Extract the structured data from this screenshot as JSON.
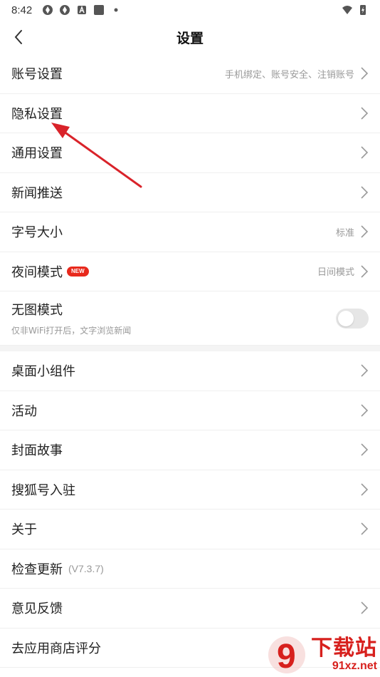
{
  "status_bar": {
    "time": "8:42"
  },
  "header": {
    "title": "设置"
  },
  "settings_group1": [
    {
      "label": "账号设置",
      "value": "手机绑定、账号安全、注销账号"
    },
    {
      "label": "隐私设置",
      "value": ""
    },
    {
      "label": "通用设置",
      "value": ""
    },
    {
      "label": "新闻推送",
      "value": ""
    },
    {
      "label": "字号大小",
      "value": "标准"
    },
    {
      "label": "夜间模式",
      "badge": "NEW",
      "value": "日间模式"
    }
  ],
  "no_image_mode": {
    "label": "无图模式",
    "subtitle": "仅非WiFi打开后，文字浏览新闻",
    "enabled": false
  },
  "settings_group2": [
    {
      "label": "桌面小组件"
    },
    {
      "label": "活动"
    },
    {
      "label": "封面故事"
    },
    {
      "label": "搜狐号入驻"
    },
    {
      "label": "关于"
    },
    {
      "label": "检查更新",
      "version": "(V7.3.7)"
    },
    {
      "label": "意见反馈"
    },
    {
      "label": "去应用商店评分"
    }
  ],
  "watermark": {
    "main": "下载站",
    "sub": "91xz.net",
    "logo_text": "9"
  },
  "colors": {
    "accent_red": "#d7201d",
    "badge_red": "#e8291c",
    "arrow_red": "#d9232a"
  }
}
